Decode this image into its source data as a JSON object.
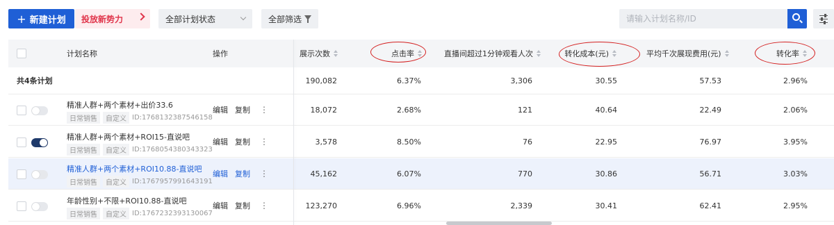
{
  "toolbar": {
    "new_plan_label": "新建计划",
    "boost_label": "投放新势力",
    "status_select": "全部计划状态",
    "filter_label": "全部筛选",
    "search_placeholder": "请输入计划名称/ID"
  },
  "table": {
    "columns": {
      "plan_name": "计划名称",
      "operations": "操作",
      "impressions": "展示次数",
      "ctr": "点击率",
      "live_viewers": "直播间超过1分钟观看人次",
      "conversion_cost": "转化成本(元)",
      "cpm": "平均千次展现费用(元)",
      "cvr": "转化率"
    },
    "summary": {
      "label": "共4条计划",
      "impressions": "190,082",
      "ctr": "6.37%",
      "live_viewers": "3,306",
      "conversion_cost": "30.55",
      "cpm": "57.53",
      "cvr": "2.96%"
    },
    "rows": [
      {
        "name": "精准人群+两个素材+出价33.6",
        "tag1": "日常销售",
        "tag2": "自定义",
        "id": "ID:1768132387546158",
        "enabled": false,
        "edit": "编辑",
        "copy": "复制",
        "impressions": "18,072",
        "ctr": "2.68%",
        "live_viewers": "121",
        "conversion_cost": "40.64",
        "cpm": "22.49",
        "cvr": "2.06%"
      },
      {
        "name": "精准人群+两个素材+ROI15-直说吧",
        "tag1": "日常销售",
        "tag2": "自定义",
        "id": "ID:1768054380343323",
        "enabled": true,
        "edit": "编辑",
        "copy": "复制",
        "impressions": "3,578",
        "ctr": "8.50%",
        "live_viewers": "76",
        "conversion_cost": "22.95",
        "cpm": "76.97",
        "cvr": "3.95%"
      },
      {
        "name": "精准人群+两个素材+ROI10.88-直说吧",
        "tag1": "日常销售",
        "tag2": "自定义",
        "id": "ID:1767957991643191",
        "enabled": false,
        "edit": "编辑",
        "copy": "复制",
        "impressions": "45,162",
        "ctr": "6.07%",
        "live_viewers": "770",
        "conversion_cost": "30.86",
        "cpm": "56.71",
        "cvr": "3.03%"
      },
      {
        "name": "年龄性别+不限+ROI10.88-直说吧",
        "tag1": "日常销售",
        "tag2": "自定义",
        "id": "ID:1767232393130067",
        "enabled": false,
        "edit": "编辑",
        "copy": "复制",
        "impressions": "123,270",
        "ctr": "6.96%",
        "live_viewers": "2,339",
        "conversion_cost": "30.41",
        "cpm": "62.41",
        "cvr": "2.95%"
      }
    ]
  },
  "colors": {
    "primary": "#1f5fd6",
    "boost_text": "#e0344a",
    "boost_bg": "#fdecee",
    "highlight_row": "#edf2fc",
    "annotation_circle": "#d42020"
  }
}
